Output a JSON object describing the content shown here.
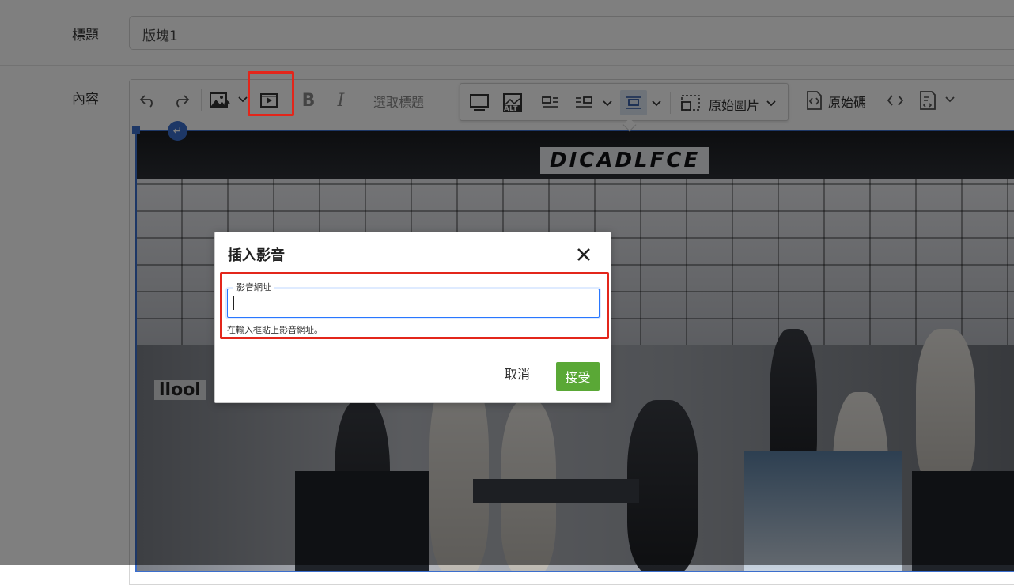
{
  "form": {
    "title_label": "標題",
    "title_value": "版塊1",
    "content_label": "內容"
  },
  "toolbar": {
    "block_format_label": "選取標題",
    "undo_icon": "undo-icon",
    "redo_icon": "redo-icon",
    "image_icon": "image-upload-icon",
    "media_icon": "media-video-icon",
    "bold_label": "B",
    "italic_label": "I"
  },
  "image_toolbar": {
    "alt_label": "ALT",
    "original_size_label": "原始圖片",
    "source_label": "原始碼"
  },
  "image": {
    "store_sign": "DICADLFCE",
    "side_sign": "llool"
  },
  "dialog": {
    "title": "插入影音",
    "field_label": "影音網址",
    "field_value": "",
    "help_text": "在輸入框貼上影音網址。",
    "cancel_label": "取消",
    "accept_label": "接受"
  },
  "colors": {
    "accept_button": "#5aa836",
    "highlight": "#e3261b",
    "focus": "#2977ff"
  }
}
